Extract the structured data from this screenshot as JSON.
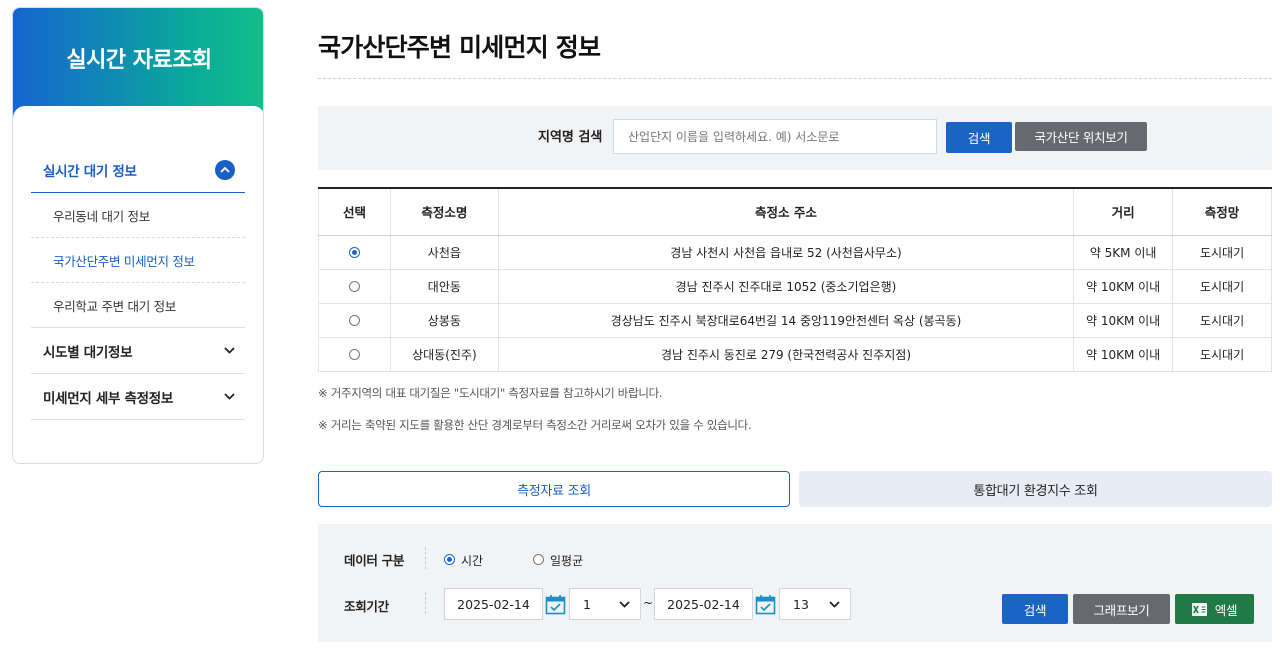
{
  "sidebar": {
    "title": "실시간 자료조회",
    "menu": [
      {
        "label": "실시간 대기 정보",
        "expanded": true,
        "children": [
          {
            "label": "우리동네 대기 정보"
          },
          {
            "label": "국가산단주변 미세먼지 정보",
            "current": true
          },
          {
            "label": "우리학교 주변 대기 정보"
          }
        ]
      },
      {
        "label": "시도별 대기정보"
      },
      {
        "label": "미세먼지 세부 측정정보"
      }
    ]
  },
  "page": {
    "title": "국가산단주변 미세먼지 정보"
  },
  "search": {
    "label": "지역명 검색",
    "placeholder": "산업단지 이름을 입력하세요. 예) 서소문로",
    "search_button": "검색",
    "map_button": "국가산단 위치보기"
  },
  "table": {
    "headers": [
      "선택",
      "측정소명",
      "측정소 주소",
      "거리",
      "측정망"
    ],
    "rows": [
      {
        "selected": true,
        "name": "사천읍",
        "address": "경남 사천시 사천읍 읍내로 52 (사천읍사무소)",
        "distance": "약 5KM 이내",
        "network": "도시대기"
      },
      {
        "selected": false,
        "name": "대안동",
        "address": "경남 진주시 진주대로 1052 (중소기업은행)",
        "distance": "약 10KM 이내",
        "network": "도시대기"
      },
      {
        "selected": false,
        "name": "상봉동",
        "address": "경상남도 진주시 북장대로64번길 14 중앙119안전센터 옥상 (봉곡동)",
        "distance": "약 10KM 이내",
        "network": "도시대기"
      },
      {
        "selected": false,
        "name": "상대동(진주)",
        "address": "경남 진주시 동진로 279 (한국전력공사 진주지점)",
        "distance": "약 10KM 이내",
        "network": "도시대기"
      }
    ]
  },
  "notes": [
    "※ 거주지역의 대표 대기질은 \"도시대기\" 측정자료를 참고하시기 바랍니다.",
    "※ 거리는 축약된 지도를 활용한 산단 경계로부터 측정소간 거리로써 오차가 있을 수 있습니다."
  ],
  "tabs": [
    {
      "label": "측정자료 조회",
      "active": true
    },
    {
      "label": "통합대기 환경지수 조회",
      "active": false
    }
  ],
  "query": {
    "data_type_label": "데이터 구분",
    "data_type_options": [
      {
        "label": "시간",
        "selected": true
      },
      {
        "label": "일평균",
        "selected": false
      }
    ],
    "period_label": "조회기간",
    "start_date": "2025-02-14",
    "start_hour": "1",
    "separator": "~",
    "end_date": "2025-02-14",
    "end_hour": "13",
    "search_button": "검색",
    "graph_button": "그래프보기",
    "excel_button": "엑셀"
  },
  "colors": {
    "primary": "#1a64c8",
    "gray_button": "#666a70",
    "excel_green": "#1f7a46"
  }
}
